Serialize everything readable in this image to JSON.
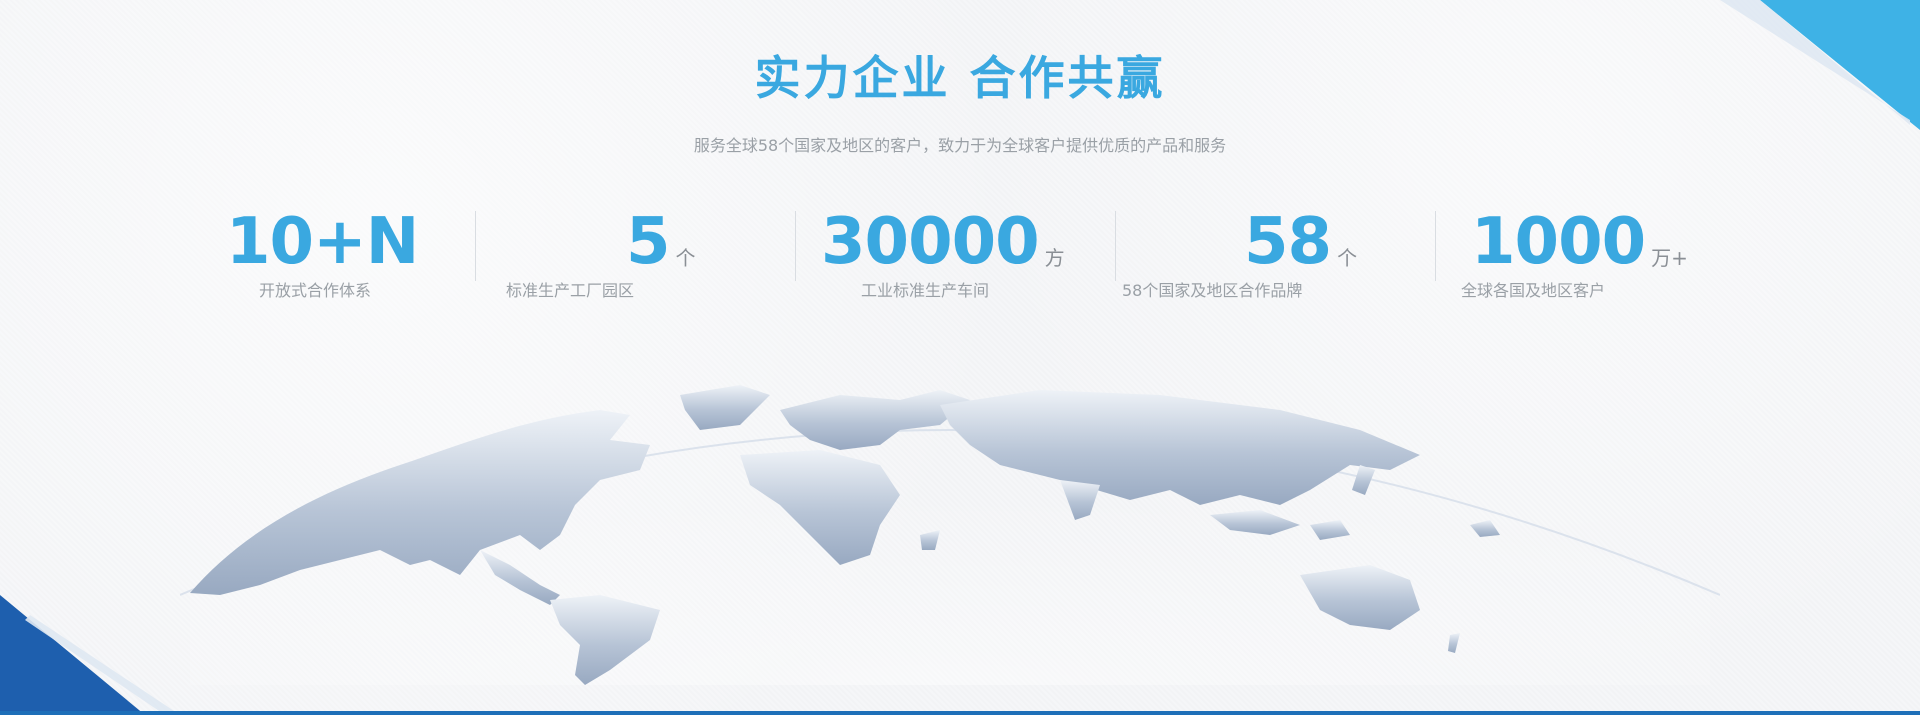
{
  "header": {
    "title": "实力企业 合作共赢",
    "subtitle": "服务全球58个国家及地区的客户，致力于为全球客户提供优质的产品和服务"
  },
  "stats": [
    {
      "value": "10+N",
      "unit": "",
      "label": "开放式合作体系"
    },
    {
      "value": "5",
      "unit": "个",
      "label": "标准生产工厂园区"
    },
    {
      "value": "30000",
      "unit": "方",
      "label": "工业标准生产车间"
    },
    {
      "value": "58",
      "unit": "个",
      "label": "58个国家及地区合作品牌"
    },
    {
      "value": "1000",
      "unit": "万+",
      "label": "全球各国及地区客户"
    }
  ],
  "colors": {
    "accent": "#3aa8e0",
    "corner_dark": "#1e5fae",
    "corner_light": "#3eb2e6",
    "map": "#a9b7cb"
  },
  "icons": {
    "map": "world-map-graphic"
  }
}
